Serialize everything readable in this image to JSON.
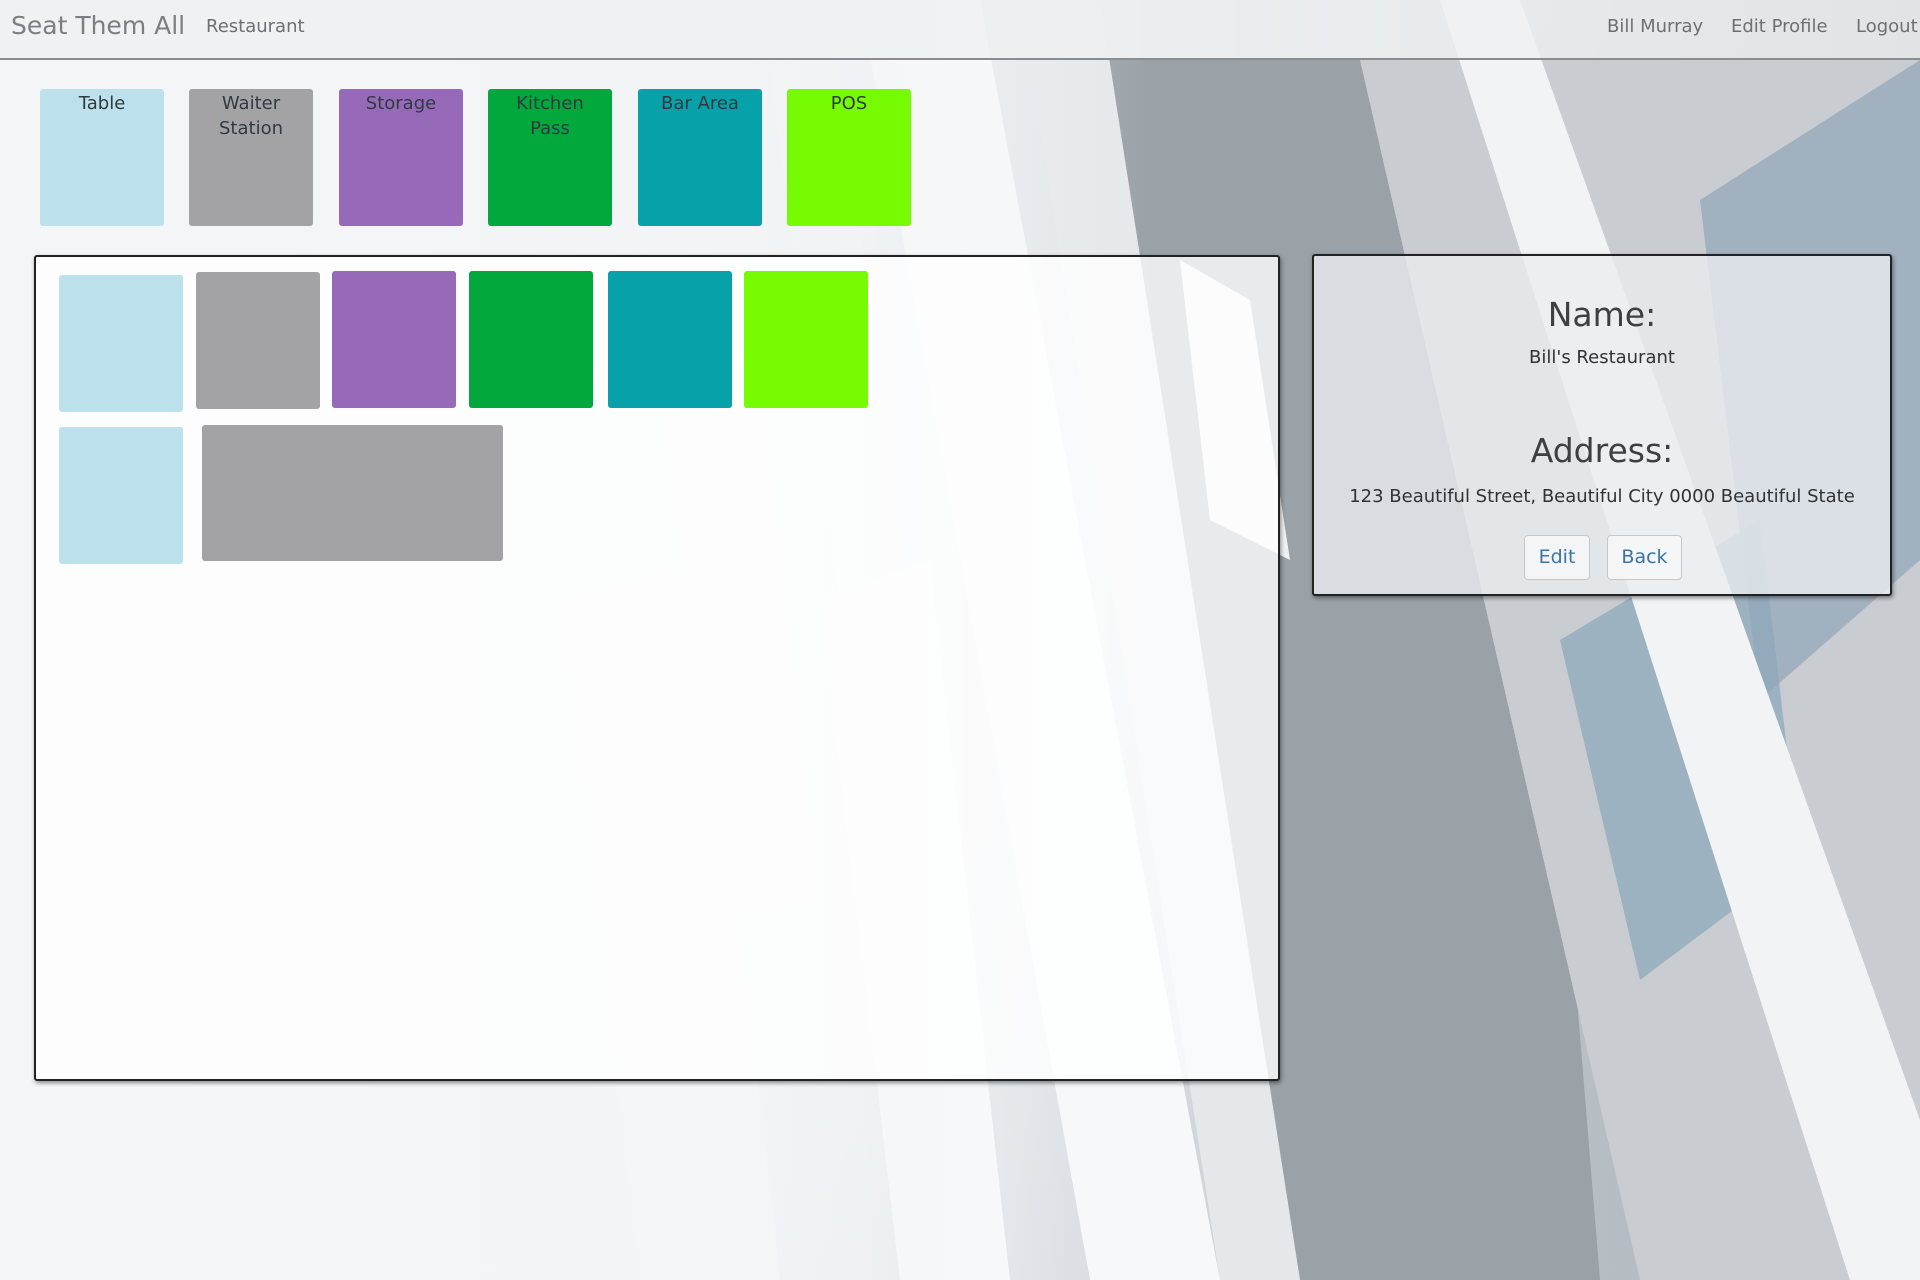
{
  "navbar": {
    "brand": "Seat Them All",
    "restaurant_link": "Restaurant",
    "user_name": "Bill Murray",
    "edit_profile": "Edit Profile",
    "logout": "Logout"
  },
  "palette": [
    {
      "label": "Table",
      "color": "#bde1ec"
    },
    {
      "label": "Waiter Station",
      "color": "#a3a3a6"
    },
    {
      "label": "Storage",
      "color": "#966ab9"
    },
    {
      "label": "Kitchen Pass",
      "color": "#02a83c"
    },
    {
      "label": "Bar Area",
      "color": "#07a2a9"
    },
    {
      "label": "POS",
      "color": "#76fb03"
    }
  ],
  "floor_plan": {
    "items": [
      {
        "type": "Table"
      },
      {
        "type": "Waiter Station"
      },
      {
        "type": "Storage"
      },
      {
        "type": "Kitchen Pass"
      },
      {
        "type": "Bar Area"
      },
      {
        "type": "POS"
      },
      {
        "type": "Table"
      },
      {
        "type": "Waiter Station"
      }
    ]
  },
  "info": {
    "name_heading": "Name:",
    "name_value": "Bill's Restaurant",
    "address_heading": "Address:",
    "address_value": "123 Beautiful Street, Beautiful City 0000 Beautiful State",
    "edit_button": "Edit",
    "back_button": "Back"
  }
}
